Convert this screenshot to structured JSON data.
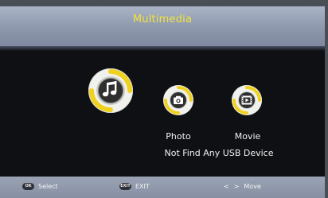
{
  "title": "Multimedia",
  "items": [
    {
      "id": "music",
      "label": "",
      "icon": "music-note-icon"
    },
    {
      "id": "photo",
      "label": "Photo",
      "icon": "camera-icon"
    },
    {
      "id": "movie",
      "label": "Movie",
      "icon": "film-icon"
    }
  ],
  "status": "Not Find Any USB Device",
  "footer": {
    "select": {
      "key": "OK",
      "label": "Select"
    },
    "exit": {
      "key": "EXIT",
      "label": "EXIT"
    },
    "move": {
      "left_arrow": "<",
      "right_arrow": ">",
      "label": "Move"
    }
  },
  "colors": {
    "title_text": "#f2e23a",
    "accent_ring": "#f0d21e",
    "panel_background": "#0f1013",
    "bar_background": "#8c96ab"
  }
}
